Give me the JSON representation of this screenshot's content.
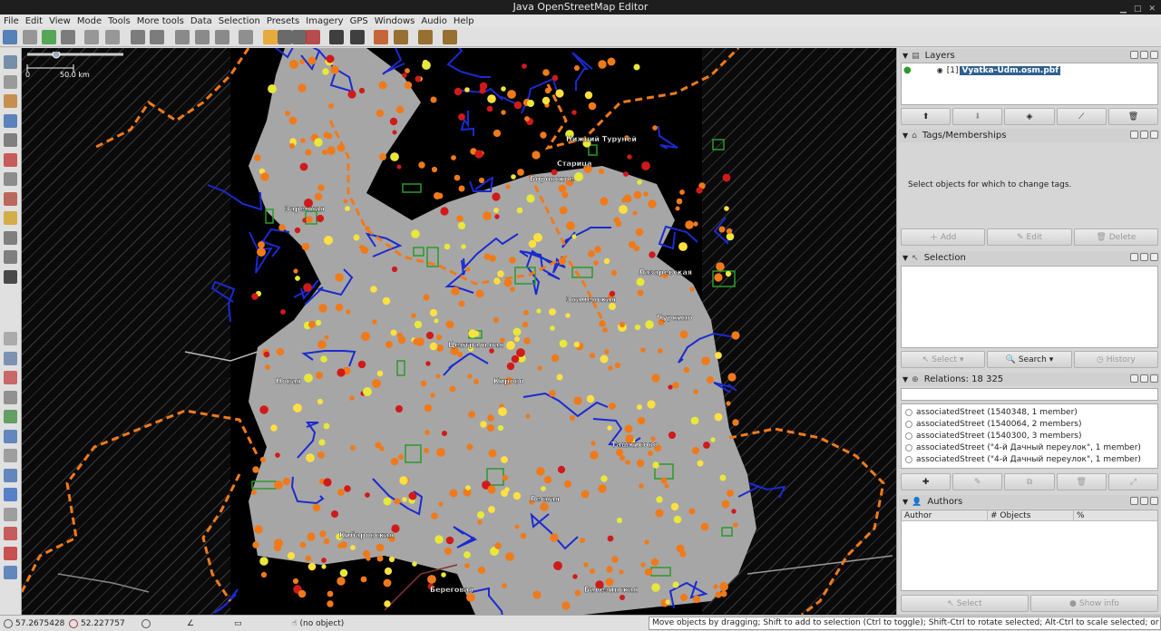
{
  "window": {
    "title": "Java OpenStreetMap Editor"
  },
  "menu": [
    "File",
    "Edit",
    "View",
    "Mode",
    "Tools",
    "More tools",
    "Data",
    "Selection",
    "Presets",
    "Imagery",
    "GPS",
    "Windows",
    "Audio",
    "Help"
  ],
  "toolbar_icons": [
    {
      "name": "open-icon",
      "color": "#3d6fb0"
    },
    {
      "name": "save-icon",
      "color": "#888888"
    },
    {
      "name": "download-icon",
      "color": "#3b9c3b"
    },
    {
      "name": "upload-icon",
      "color": "#6a6a6a"
    },
    {
      "name": "undo-icon",
      "color": "#8a8a8a"
    },
    {
      "name": "redo-icon",
      "color": "#8a8a8a"
    },
    {
      "name": "preferences-icon",
      "color": "#6a6a6a"
    },
    {
      "name": "zoom-extent-icon",
      "color": "#6a6a6a"
    },
    {
      "name": "merge-nodes-icon",
      "color": "#7a7a7a"
    },
    {
      "name": "split-way-icon",
      "color": "#7a7a7a"
    },
    {
      "name": "refresh-icon",
      "color": "#7a7a7a"
    },
    {
      "name": "grey-square-icon",
      "color": "#808080"
    },
    {
      "name": "traffic-lights-icon",
      "color": "#e8a020"
    },
    {
      "name": "traffic-signal-icon",
      "color": "#555555"
    },
    {
      "name": "level-crossing-icon",
      "color": "#555555"
    },
    {
      "name": "brick-wall-icon",
      "color": "#b03030"
    },
    {
      "name": "car-icon",
      "color": "#222222"
    },
    {
      "name": "bus-icon",
      "color": "#222222"
    },
    {
      "name": "warning-icon",
      "color": "#c0501a"
    },
    {
      "name": "restaurant-icon",
      "color": "#8a5a10"
    },
    {
      "name": "castle-icon",
      "color": "#8a5a10"
    },
    {
      "name": "industrial-icon",
      "color": "#8a5a10"
    }
  ],
  "left_tools": [
    {
      "name": "select-tool-icon"
    },
    {
      "name": "lasso-tool-icon"
    },
    {
      "name": "draw-tool-icon"
    },
    {
      "name": "zoom-tool-icon"
    },
    {
      "name": "delete-tool-icon"
    },
    {
      "name": "improve-way-icon"
    },
    {
      "name": "parallel-icon"
    },
    {
      "name": "split-icon"
    },
    {
      "name": "pencil-icon"
    },
    {
      "name": "building-icon"
    },
    {
      "name": "wall-icon"
    },
    {
      "name": "expand-icon"
    }
  ],
  "left_tools_lower": [
    {
      "name": "layers-toggle-icon"
    },
    {
      "name": "tag-icon"
    },
    {
      "name": "bookmark-icon"
    },
    {
      "name": "selection-list-icon"
    },
    {
      "name": "filter-icon"
    },
    {
      "name": "history-icon"
    },
    {
      "name": "conflict-icon"
    },
    {
      "name": "validator-icon"
    },
    {
      "name": "check-icon"
    },
    {
      "name": "relation-icon"
    },
    {
      "name": "gift-icon"
    },
    {
      "name": "map-pin-icon"
    },
    {
      "name": "minimap-icon"
    }
  ],
  "map": {
    "scale_zero": "0",
    "scale_label": "50.0 km",
    "place_labels": [
      "Нижний Туруней",
      "Старица",
      "Боровское",
      "Кирово",
      "Центральная",
      "Знаменская",
      "Лазаревская",
      "Ташкисово",
      "Чуркино",
      "Лесная",
      "Береговая",
      "Новая",
      "Кибаровская",
      "Балезинская",
      "Заречная"
    ]
  },
  "layers": {
    "title": "Layers",
    "items": [
      {
        "index": "[1]",
        "name": "Vyatka-Udm.osm.pbf"
      }
    ]
  },
  "tags": {
    "title": "Tags/Memberships",
    "message": "Select objects for which to change tags.",
    "buttons": [
      "Add",
      "Edit",
      "Delete"
    ]
  },
  "selection": {
    "title": "Selection",
    "buttons": [
      "Select",
      "Search",
      "History"
    ]
  },
  "relations": {
    "title": "Relations: 18 325",
    "items": [
      "associatedStreet (1540348, 1 member)",
      "associatedStreet (1540064, 2 members)",
      "associatedStreet (1540300, 3 members)",
      "associatedStreet (\"4-й Дачный переулок\", 1 member)",
      "associatedStreet (\"4-й Дачный переулок\", 1 member)"
    ]
  },
  "authors": {
    "title": "Authors",
    "columns": [
      "Author",
      "# Objects",
      "%"
    ],
    "buttons": [
      "Select",
      "Show info"
    ]
  },
  "status": {
    "lat": "57.2675428",
    "lon": "52.227757",
    "object": "(no object)",
    "help": "Move objects by dragging; Shift to add to selection (Ctrl to toggle); Shift-Ctrl to rotate selected; Alt-Ctrl to scale selected; or change selection"
  }
}
